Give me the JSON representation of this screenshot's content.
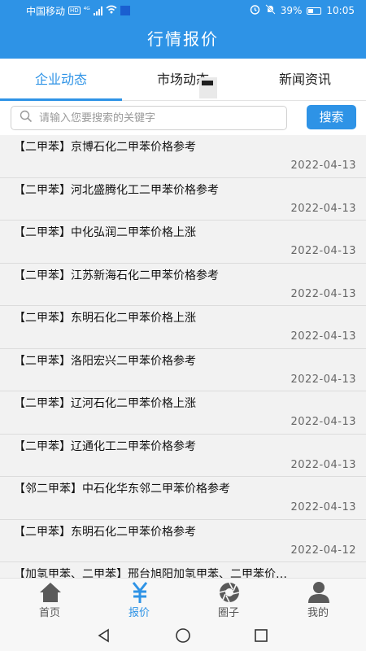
{
  "status_bar": {
    "carrier": "中国移动",
    "network_badge": "HD",
    "network_type": "⁴ᴳ",
    "battery": "39%",
    "time": "10:05"
  },
  "header": {
    "title": "行情报价"
  },
  "tabs": [
    {
      "label": "企业动态",
      "active": true
    },
    {
      "label": "市场动态",
      "active": false
    },
    {
      "label": "新闻资讯",
      "active": false
    }
  ],
  "search": {
    "placeholder": "请输入您要搜索的关键字",
    "value": "",
    "button_label": "搜索"
  },
  "news": [
    {
      "title": "【二甲苯】京博石化二甲苯价格参考",
      "date": "2022-04-13"
    },
    {
      "title": "【二甲苯】河北盛腾化工二甲苯价格参考",
      "date": "2022-04-13"
    },
    {
      "title": "【二甲苯】中化弘润二甲苯价格上涨",
      "date": "2022-04-13"
    },
    {
      "title": "【二甲苯】江苏新海石化二甲苯价格参考",
      "date": "2022-04-13"
    },
    {
      "title": "【二甲苯】东明石化二甲苯价格上涨",
      "date": "2022-04-13"
    },
    {
      "title": "【二甲苯】洛阳宏兴二甲苯价格参考",
      "date": "2022-04-13"
    },
    {
      "title": "【二甲苯】辽河石化二甲苯价格上涨",
      "date": "2022-04-13"
    },
    {
      "title": "【二甲苯】辽通化工二甲苯价格参考",
      "date": "2022-04-13"
    },
    {
      "title": "【邻二甲苯】中石化华东邻二甲苯价格参考",
      "date": "2022-04-13"
    },
    {
      "title": "【二甲苯】东明石化二甲苯价格参考",
      "date": "2022-04-12"
    },
    {
      "title": "【加氢甲苯、二甲苯】邢台旭阳加氢甲苯、二甲苯价…",
      "date": ""
    }
  ],
  "bottom_nav": [
    {
      "label": "首页",
      "icon": "home-icon",
      "active": false
    },
    {
      "label": "报价",
      "icon": "yen-icon",
      "active": true
    },
    {
      "label": "圈子",
      "icon": "aperture-icon",
      "active": false
    },
    {
      "label": "我的",
      "icon": "user-icon",
      "active": false
    }
  ],
  "colors": {
    "primary": "#2e93e6",
    "list_background": "#f2f2f2",
    "text": "#111111",
    "date_text": "#666666"
  }
}
